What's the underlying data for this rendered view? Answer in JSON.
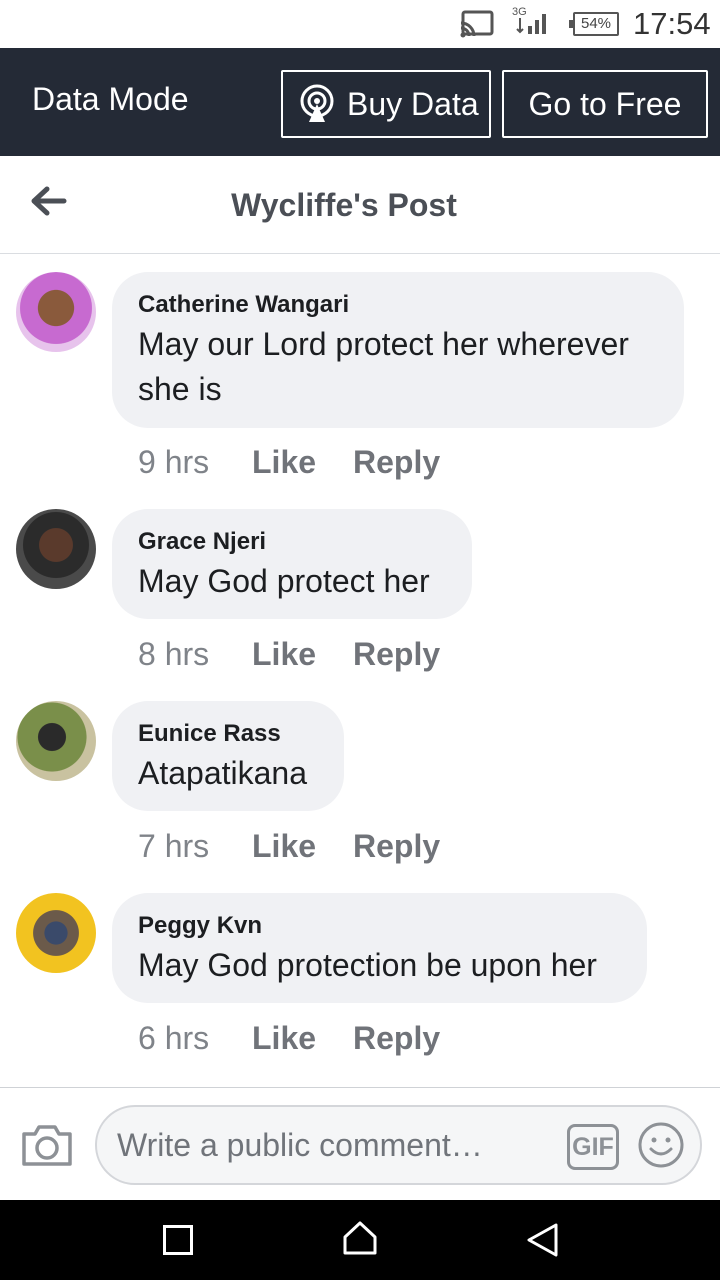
{
  "status_bar": {
    "network": "3G",
    "battery": "54%",
    "time": "17:54"
  },
  "data_bar": {
    "mode_label": "Data Mode",
    "buy_data_label": "Buy Data",
    "go_free_label": "Go to Free"
  },
  "header": {
    "title": "Wycliffe's Post"
  },
  "comments": [
    {
      "name": "Catherine Wangari",
      "text_line1": "May our Lord protect her wherever",
      "text_line2": "she is",
      "time": "9 hrs",
      "like": "Like",
      "reply": "Reply"
    },
    {
      "name": "Grace Njeri",
      "text": "May God protect her",
      "time": "8 hrs",
      "like": "Like",
      "reply": "Reply"
    },
    {
      "name": "Eunice Rass",
      "text": "Atapatikana",
      "time": "7 hrs",
      "like": "Like",
      "reply": "Reply"
    },
    {
      "name": "Peggy Kvn",
      "text": "May God protection be upon her",
      "time": "6 hrs",
      "like": "Like",
      "reply": "Reply"
    }
  ],
  "composer": {
    "placeholder": "Write a public comment…",
    "gif_label": "GIF"
  },
  "colors": {
    "data_bar_bg": "#242a36",
    "bubble_bg": "#f0f1f4",
    "nav_bg": "#000000"
  },
  "icons": [
    "cast-icon",
    "signal-icon",
    "broadcast-icon",
    "back-arrow-icon",
    "camera-icon",
    "gif-icon",
    "smiley-icon",
    "recents-icon",
    "home-icon",
    "back-icon"
  ]
}
